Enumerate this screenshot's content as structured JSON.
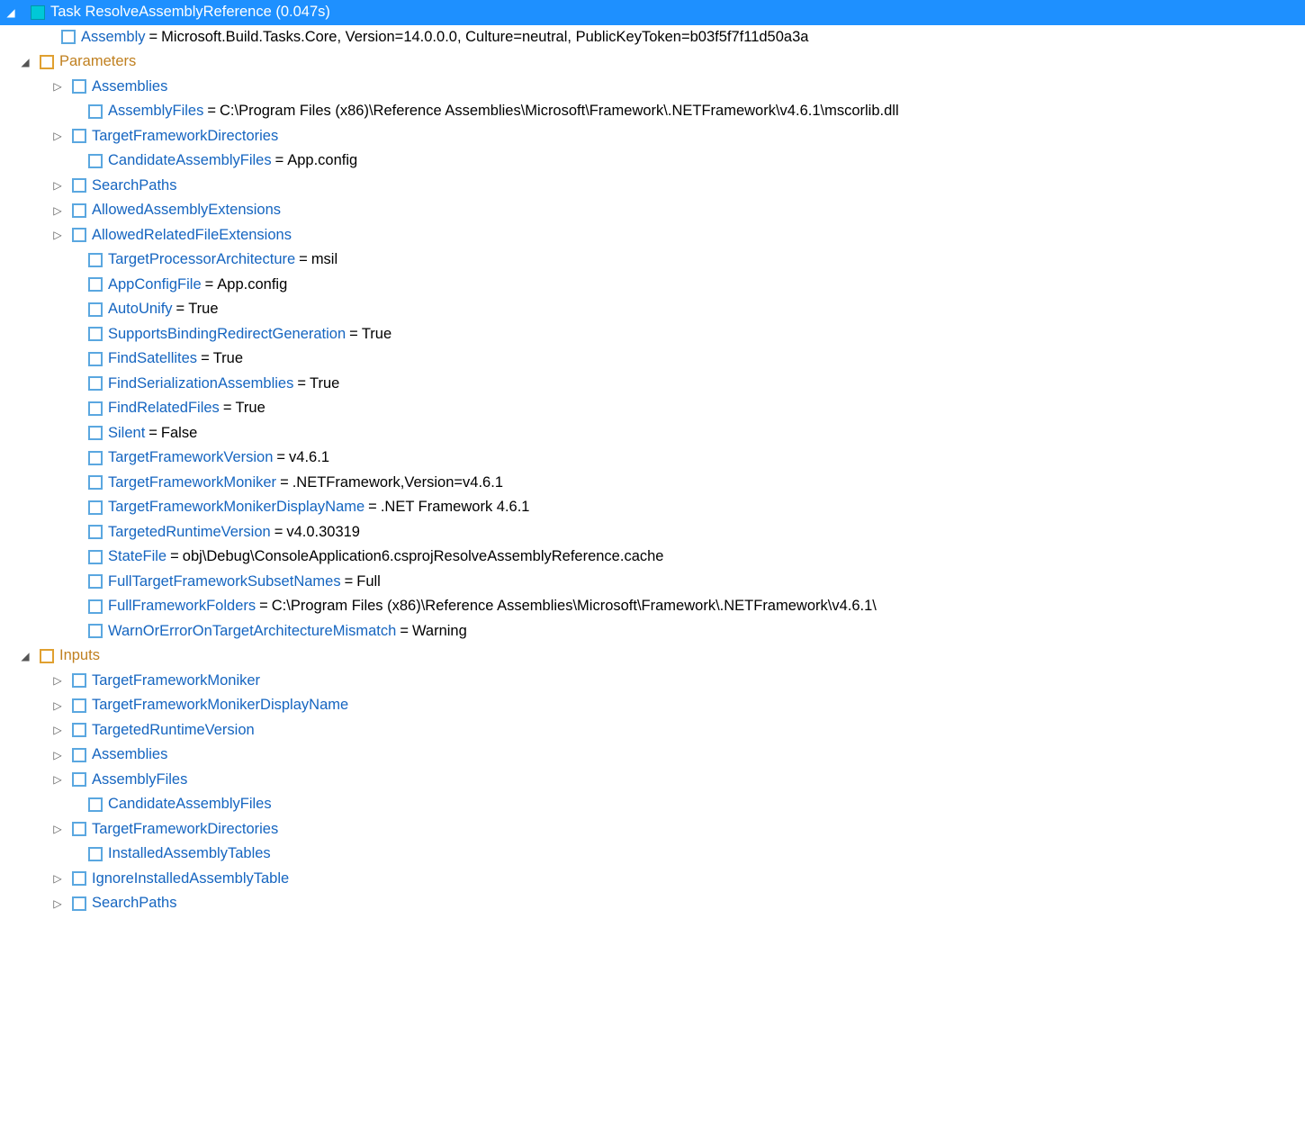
{
  "root": {
    "label": "Task ResolveAssemblyReference (0.047s)",
    "assembly": {
      "key": "Assembly",
      "val": "Microsoft.Build.Tasks.Core, Version=14.0.0.0, Culture=neutral, PublicKeyToken=b03f5f7f11d50a3a"
    },
    "parameters_label": "Parameters",
    "params": {
      "Assemblies": {
        "key": "Assemblies"
      },
      "AssemblyFiles": {
        "key": "AssemblyFiles",
        "val": "C:\\Program Files (x86)\\Reference Assemblies\\Microsoft\\Framework\\.NETFramework\\v4.6.1\\mscorlib.dll"
      },
      "TargetFrameworkDirectories": {
        "key": "TargetFrameworkDirectories"
      },
      "CandidateAssemblyFiles": {
        "key": "CandidateAssemblyFiles",
        "val": "App.config"
      },
      "SearchPaths": {
        "key": "SearchPaths"
      },
      "AllowedAssemblyExtensions": {
        "key": "AllowedAssemblyExtensions"
      },
      "AllowedRelatedFileExtensions": {
        "key": "AllowedRelatedFileExtensions"
      },
      "TargetProcessorArchitecture": {
        "key": "TargetProcessorArchitecture",
        "val": "msil"
      },
      "AppConfigFile": {
        "key": "AppConfigFile",
        "val": "App.config"
      },
      "AutoUnify": {
        "key": "AutoUnify",
        "val": "True"
      },
      "SupportsBindingRedirectGeneration": {
        "key": "SupportsBindingRedirectGeneration",
        "val": "True"
      },
      "FindSatellites": {
        "key": "FindSatellites",
        "val": "True"
      },
      "FindSerializationAssemblies": {
        "key": "FindSerializationAssemblies",
        "val": "True"
      },
      "FindRelatedFiles": {
        "key": "FindRelatedFiles",
        "val": "True"
      },
      "Silent": {
        "key": "Silent",
        "val": "False"
      },
      "TargetFrameworkVersion": {
        "key": "TargetFrameworkVersion",
        "val": "v4.6.1"
      },
      "TargetFrameworkMoniker": {
        "key": "TargetFrameworkMoniker",
        "val": ".NETFramework,Version=v4.6.1"
      },
      "TargetFrameworkMonikerDisplayName": {
        "key": "TargetFrameworkMonikerDisplayName",
        "val": ".NET Framework 4.6.1"
      },
      "TargetedRuntimeVersion": {
        "key": "TargetedRuntimeVersion",
        "val": "v4.0.30319"
      },
      "StateFile": {
        "key": "StateFile",
        "val": "obj\\Debug\\ConsoleApplication6.csprojResolveAssemblyReference.cache"
      },
      "FullTargetFrameworkSubsetNames": {
        "key": "FullTargetFrameworkSubsetNames",
        "val": "Full"
      },
      "FullFrameworkFolders": {
        "key": "FullFrameworkFolders",
        "val": "C:\\Program Files (x86)\\Reference Assemblies\\Microsoft\\Framework\\.NETFramework\\v4.6.1\\"
      },
      "WarnOrErrorOnTargetArchitectureMismatch": {
        "key": "WarnOrErrorOnTargetArchitectureMismatch",
        "val": "Warning"
      }
    },
    "inputs_label": "Inputs",
    "inputs": {
      "TargetFrameworkMoniker": {
        "key": "TargetFrameworkMoniker"
      },
      "TargetFrameworkMonikerDisplayName": {
        "key": "TargetFrameworkMonikerDisplayName"
      },
      "TargetedRuntimeVersion": {
        "key": "TargetedRuntimeVersion"
      },
      "Assemblies": {
        "key": "Assemblies"
      },
      "AssemblyFiles": {
        "key": "AssemblyFiles"
      },
      "CandidateAssemblyFiles": {
        "key": "CandidateAssemblyFiles"
      },
      "TargetFrameworkDirectories": {
        "key": "TargetFrameworkDirectories"
      },
      "InstalledAssemblyTables": {
        "key": "InstalledAssemblyTables"
      },
      "IgnoreInstalledAssemblyTable": {
        "key": "IgnoreInstalledAssemblyTable"
      },
      "SearchPaths": {
        "key": "SearchPaths"
      }
    }
  },
  "glyphs": {
    "expanded": "◢",
    "collapsed": "▷",
    "equals": " = "
  }
}
